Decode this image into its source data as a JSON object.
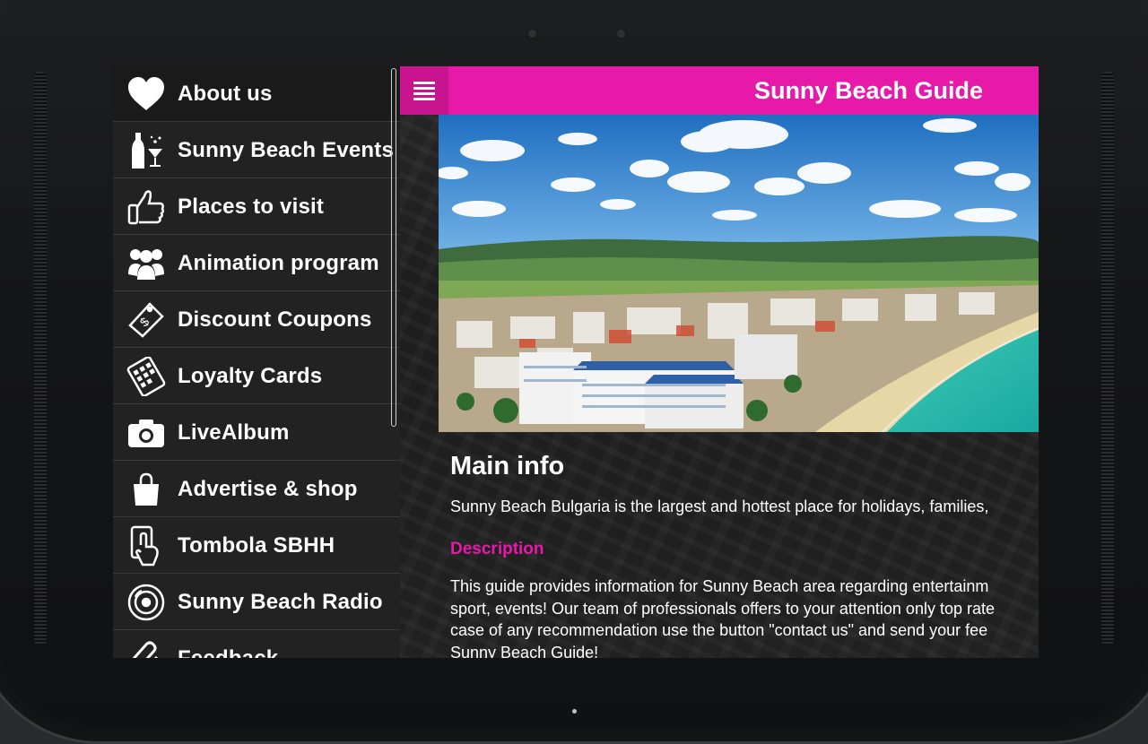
{
  "app": {
    "title": "Sunny Beach Guide",
    "accent_color": "#e619a8"
  },
  "sidebar": {
    "items": [
      {
        "label": "About us",
        "icon": "heart-icon"
      },
      {
        "label": "Sunny Beach Events",
        "icon": "champagne-icon"
      },
      {
        "label": "Places to visit",
        "icon": "thumbs-up-icon"
      },
      {
        "label": "Animation program",
        "icon": "people-icon"
      },
      {
        "label": "Discount Coupons",
        "icon": "coupon-icon"
      },
      {
        "label": "Loyalty Cards",
        "icon": "loyalty-card-icon"
      },
      {
        "label": "LiveAlbum",
        "icon": "camera-icon"
      },
      {
        "label": "Advertise & shop",
        "icon": "shopping-bag-icon"
      },
      {
        "label": "Tombola SBHH",
        "icon": "tap-phone-icon"
      },
      {
        "label": "Sunny Beach Radio",
        "icon": "vinyl-disc-icon"
      },
      {
        "label": "Feedback",
        "icon": "paperclip-icon"
      }
    ]
  },
  "main": {
    "heading": "Main info",
    "intro": "Sunny Beach Bulgaria is the largest and hottest place for holidays, families,",
    "description_heading": "Description",
    "description_lines": [
      "This guide provides information for Sunny Beach area regarding entertainm",
      "sport, events! Our team of professionals offers to your attention only top rate",
      "case of any recommendation use the button \"contact us\" and send your fee",
      "Sunny Beach Guide!"
    ]
  }
}
